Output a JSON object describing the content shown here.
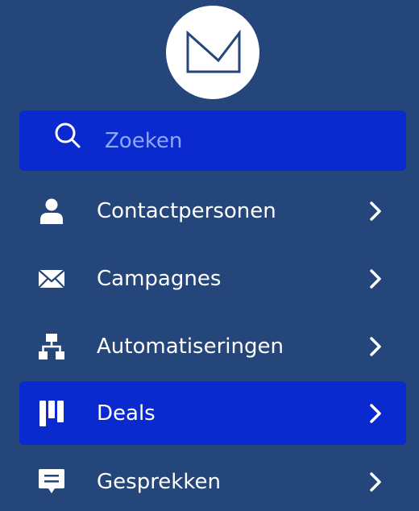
{
  "theme": {
    "background": "#24467a",
    "active_background": "#0a2ad0",
    "text_color": "#ffffff",
    "placeholder_color": "#8ea8f6"
  },
  "logo": {
    "icon": "envelope-logo-icon"
  },
  "search": {
    "icon": "search-icon",
    "placeholder": "Zoeken",
    "value": ""
  },
  "nav": {
    "items": [
      {
        "label": "Contactpersonen",
        "icon": "person-icon",
        "active": false
      },
      {
        "label": "Campagnes",
        "icon": "envelope-icon",
        "active": false
      },
      {
        "label": "Automatiseringen",
        "icon": "sitemap-icon",
        "active": false
      },
      {
        "label": "Deals",
        "icon": "kanban-icon",
        "active": true
      },
      {
        "label": "Gesprekken",
        "icon": "chat-bubble-icon",
        "active": false
      }
    ]
  }
}
